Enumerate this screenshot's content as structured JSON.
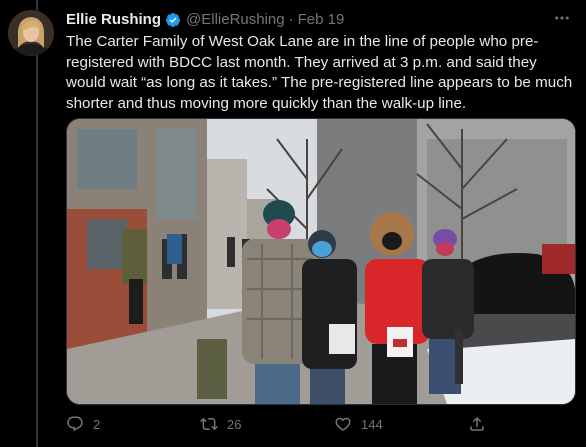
{
  "tweet": {
    "display_name": "Ellie Rushing",
    "handle": "@EllieRushing",
    "separator": "·",
    "date": "Feb 19",
    "text": "The Carter Family of West Oak Lane are in the line of people who pre-registered with BDCC last month. They arrived at 3 p.m. and said they would wait “as long as it takes.” The pre-registered line appears to be much shorter and thus moving more quickly than the walk-up line.",
    "verified_icon": "verified-badge-icon",
    "more_icon": "more-horizontal-icon"
  },
  "actions": {
    "reply_count": "2",
    "retweet_count": "26",
    "like_count": "144",
    "reply_icon": "reply-icon",
    "retweet_icon": "retweet-icon",
    "like_icon": "heart-icon",
    "share_icon": "share-icon"
  },
  "colors": {
    "background": "#000000",
    "text": "#e7e9ea",
    "secondary_text": "#71767b",
    "verified": "#1d9bf0",
    "border": "#2f3336"
  }
}
